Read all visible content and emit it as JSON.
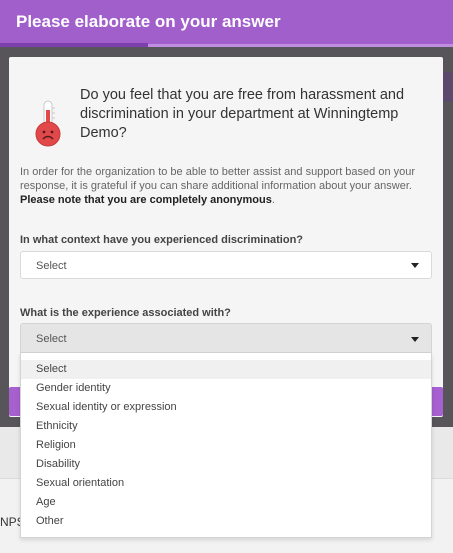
{
  "header": {
    "title": "Please elaborate on your answer"
  },
  "question": {
    "text": "Do you feel that you are free from harassment and discrimination in your department at Winningtemp Demo?"
  },
  "info": {
    "text": "In order for the organization to be able to better assist and support based on your response, it is grateful if you can share additional information about your answer.",
    "bold_text": "Please note that you are completely anonymous",
    "end": "."
  },
  "field1": {
    "label": "In what context have you experienced discrimination?",
    "value": "Select"
  },
  "field2": {
    "label": "What is the experience associated with?",
    "value": "Select",
    "options": [
      "Select",
      "Gender identity",
      "Sexual identity or expression",
      "Ethnicity",
      "Religion",
      "Disability",
      "Sexual orientation",
      "Age",
      "Other"
    ]
  },
  "background": {
    "nps_text": "NPS"
  },
  "icons": {
    "thermometer": "sad-thermometer-icon",
    "dropdown_caret": "caret-down-icon"
  },
  "colors": {
    "header": "#a15fcc",
    "header_progress": "#7e3fae",
    "frame": "#57545a",
    "submit": "#a660cf"
  }
}
